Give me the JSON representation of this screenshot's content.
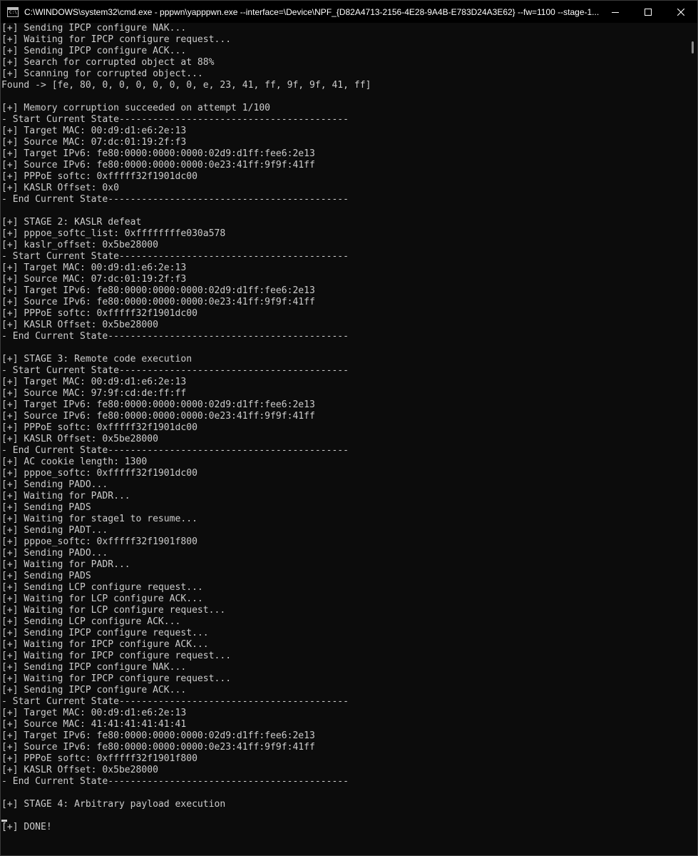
{
  "window": {
    "title": "C:\\WINDOWS\\system32\\cmd.exe - pppwn\\yapppwn.exe  --interface=\\Device\\NPF_{D82A4713-2156-4E28-9A4B-E783D24A3E62} --fw=1100 --stage-1...",
    "app_icon_label": "C:\\.",
    "controls": {
      "minimize": "minimize-icon",
      "maximize": "maximize-icon",
      "close": "close-icon"
    }
  },
  "console": {
    "text_color": "#cccccc",
    "background": "#0c0c0c",
    "lines": [
      "[+] Sending IPCP configure NAK...",
      "[+] Waiting for IPCP configure request...",
      "[+] Sending IPCP configure ACK...",
      "[+] Search for corrupted object at 88%",
      "[+] Scanning for corrupted object...",
      "Found -> [fe, 80, 0, 0, 0, 0, 0, 0, e, 23, 41, ff, 9f, 9f, 41, ff]",
      "",
      "[+] Memory corruption succeeded on attempt 1/100",
      "- Start Current State-----------------------------------------",
      "[+] Target MAC: 00:d9:d1:e6:2e:13",
      "[+] Source MAC: 07:dc:01:19:2f:f3",
      "[+] Target IPv6: fe80:0000:0000:0000:02d9:d1ff:fee6:2e13",
      "[+] Source IPv6: fe80:0000:0000:0000:0e23:41ff:9f9f:41ff",
      "[+] PPPoE softc: 0xfffff32f1901dc00",
      "[+] KASLR Offset: 0x0",
      "- End Current State-------------------------------------------",
      "",
      "[+] STAGE 2: KASLR defeat",
      "[+] pppoe_softc_list: 0xffffffffe030a578",
      "[+] kaslr_offset: 0x5be28000",
      "- Start Current State-----------------------------------------",
      "[+] Target MAC: 00:d9:d1:e6:2e:13",
      "[+] Source MAC: 07:dc:01:19:2f:f3",
      "[+] Target IPv6: fe80:0000:0000:0000:02d9:d1ff:fee6:2e13",
      "[+] Source IPv6: fe80:0000:0000:0000:0e23:41ff:9f9f:41ff",
      "[+] PPPoE softc: 0xfffff32f1901dc00",
      "[+] KASLR Offset: 0x5be28000",
      "- End Current State-------------------------------------------",
      "",
      "[+] STAGE 3: Remote code execution",
      "- Start Current State-----------------------------------------",
      "[+] Target MAC: 00:d9:d1:e6:2e:13",
      "[+] Source MAC: 97:9f:cd:de:ff:ff",
      "[+] Target IPv6: fe80:0000:0000:0000:02d9:d1ff:fee6:2e13",
      "[+] Source IPv6: fe80:0000:0000:0000:0e23:41ff:9f9f:41ff",
      "[+] PPPoE softc: 0xfffff32f1901dc00",
      "[+] KASLR Offset: 0x5be28000",
      "- End Current State-------------------------------------------",
      "[+] AC cookie length: 1300",
      "[+] pppoe_softc: 0xfffff32f1901dc00",
      "[+] Sending PADO...",
      "[+] Waiting for PADR...",
      "[+] Sending PADS",
      "[+] Waiting for stage1 to resume...",
      "[+] Sending PADT...",
      "[+] pppoe_softc: 0xfffff32f1901f800",
      "[+] Sending PADO...",
      "[+] Waiting for PADR...",
      "[+] Sending PADS",
      "[+] Sending LCP configure request...",
      "[+] Waiting for LCP configure ACK...",
      "[+] Waiting for LCP configure request...",
      "[+] Sending LCP configure ACK...",
      "[+] Sending IPCP configure request...",
      "[+] Waiting for IPCP configure ACK...",
      "[+] Waiting for IPCP configure request...",
      "[+] Sending IPCP configure NAK...",
      "[+] Waiting for IPCP configure request...",
      "[+] Sending IPCP configure ACK...",
      "- Start Current State-----------------------------------------",
      "[+] Target MAC: 00:d9:d1:e6:2e:13",
      "[+] Source MAC: 41:41:41:41:41:41",
      "[+] Target IPv6: fe80:0000:0000:0000:02d9:d1ff:fee6:2e13",
      "[+] Source IPv6: fe80:0000:0000:0000:0e23:41ff:9f9f:41ff",
      "[+] PPPoE softc: 0xfffff32f1901f800",
      "[+] KASLR Offset: 0x5be28000",
      "- End Current State-------------------------------------------",
      "",
      "[+] STAGE 4: Arbitrary payload execution",
      "",
      "[+] DONE!"
    ]
  }
}
